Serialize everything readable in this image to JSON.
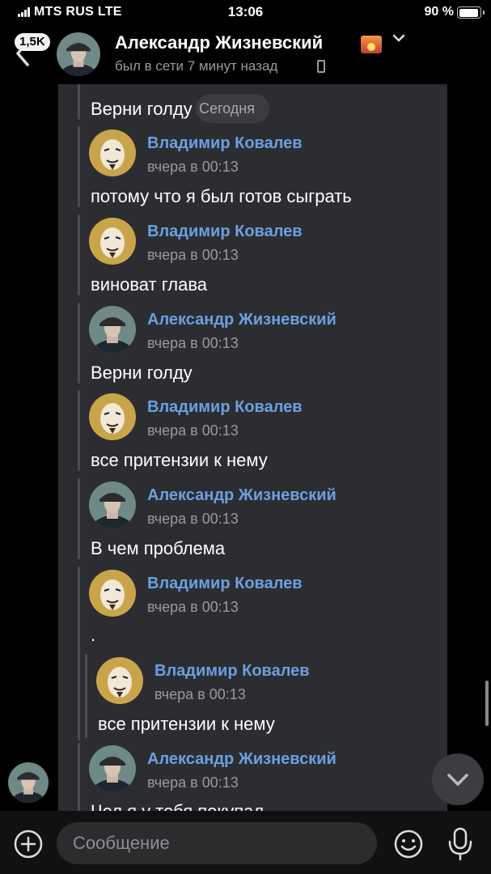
{
  "status_bar": {
    "carrier": "MTS RUS  LTE",
    "time": "13:06",
    "battery": "90 %"
  },
  "header": {
    "unread_badge": "1,5K",
    "name": "Александр Жизневский",
    "status": "был в сети 7 минут назад"
  },
  "chat": {
    "date_label": "Сегодня",
    "top_partial_text": "Верни голду",
    "messages": [
      {
        "author": "Владимир Ковалев",
        "date": "вчера в 00:13",
        "text": "потому что я был готов сыграть",
        "avatar": "mask-avatar"
      },
      {
        "author": "Владимир Ковалев",
        "date": "вчера в 00:13",
        "text": "виноват глава",
        "avatar": "mask-avatar"
      },
      {
        "author": "Александр Жизневский",
        "date": "вчера в 00:13",
        "text": "Верни голду",
        "avatar": "man-cap-avatar"
      },
      {
        "author": "Владимир Ковалев",
        "date": "вчера в 00:13",
        "text": "все притензии к нему",
        "avatar": "mask-avatar"
      },
      {
        "author": "Александр Жизневский",
        "date": "вчера в 00:13",
        "text": "В чем проблема",
        "avatar": "man-cap-avatar"
      },
      {
        "author": "Владимир Ковалев",
        "date": "вчера в 00:13",
        "text": ".",
        "avatar": "mask-avatar"
      },
      {
        "author": "Александр Жизневский",
        "date": "вчера в 00:13",
        "text": "Чел я у тебя покупал",
        "avatar": "man-cap-avatar"
      }
    ],
    "nested": {
      "author": "Владимир Ковалев",
      "date": "вчера в 00:13",
      "text": "все притензии к нему",
      "avatar": "mask-avatar"
    }
  },
  "input_bar": {
    "placeholder": "Сообщение"
  },
  "icons": [
    "signal-icon",
    "battery-icon",
    "back-chevron-icon",
    "sunset-emoji-icon",
    "chevron-down-icon",
    "phone-icon",
    "add-icon",
    "smile-icon",
    "microphone-icon",
    "scroll-down-icon"
  ],
  "colors": {
    "link_blue": "#6d9fe0",
    "bubble": "#2b2d31",
    "background": "#000000"
  }
}
